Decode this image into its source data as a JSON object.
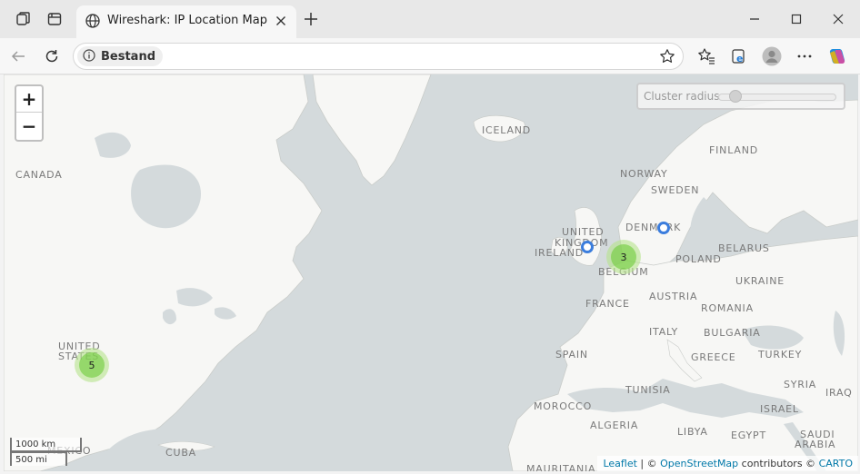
{
  "tab": {
    "title": "Wireshark: IP Location Map"
  },
  "address": {
    "site_info_label": "Bestand"
  },
  "map": {
    "cluster_radius_label": "Cluster radius:",
    "cluster_radius_value": 0.1,
    "zoom_in": "+",
    "zoom_out": "−",
    "countries": {
      "canada": "CANADA",
      "united_states_line1": "UNITED",
      "united_states_line2": "STATES",
      "mexico": "MEXICO",
      "cuba": "CUBA",
      "iceland": "ICELAND",
      "norway": "NORWAY",
      "sweden": "SWEDEN",
      "finland": "FINLAND",
      "denmark": "DENMARK",
      "united_kingdom_line1": "UNITED",
      "united_kingdom_line2": "KINGDOM",
      "ireland": "IRELAND",
      "belgium": "BELGIUM",
      "france": "FRANCE",
      "spain": "SPAIN",
      "poland": "POLAND",
      "belarus": "BELARUS",
      "ukraine": "UKRAINE",
      "austria": "AUSTRIA",
      "romania": "ROMANIA",
      "italy": "ITALY",
      "bulgaria": "BULGARIA",
      "greece": "GREECE",
      "turkey": "TURKEY",
      "syria": "SYRIA",
      "iraq": "IRAQ",
      "israel": "ISRAEL",
      "morocco": "MOROCCO",
      "algeria": "ALGERIA",
      "tunisia": "TUNISIA",
      "libya": "LIBYA",
      "egypt": "EGYPT",
      "saudi_arabia_line1": "SAUDI",
      "saudi_arabia_line2": "ARABIA",
      "mauritania": "MAURITANIA"
    },
    "clusters": {
      "usa_count": "5",
      "europe_count": "3"
    },
    "scale": {
      "km": "1000 km",
      "mi": "500 mi"
    },
    "attribution": {
      "leaflet": "Leaflet",
      "sep": " | © ",
      "osm": "OpenStreetMap",
      "contributors": " contributors © ",
      "carto": "CARTO"
    }
  },
  "icons": {
    "workspaces": "workspaces-icon",
    "tab_actions": "tab-actions-icon",
    "globe": "globe-icon",
    "close_tab": "close-icon",
    "new_tab": "plus-icon",
    "minimize": "minimize-icon",
    "maximize": "maximize-icon",
    "close_window": "close-icon",
    "back": "back-arrow-icon",
    "refresh": "refresh-icon",
    "info": "info-icon",
    "favorite": "star-icon",
    "favorites": "favorites-icon",
    "collections": "collections-icon",
    "profile": "profile-icon",
    "more": "more-icon",
    "copilot": "copilot-icon"
  },
  "colors": {
    "marker": "#3b7ddd",
    "cluster": "#6ecc39",
    "land": "#f7f7f5",
    "water": "#d4dadc"
  }
}
